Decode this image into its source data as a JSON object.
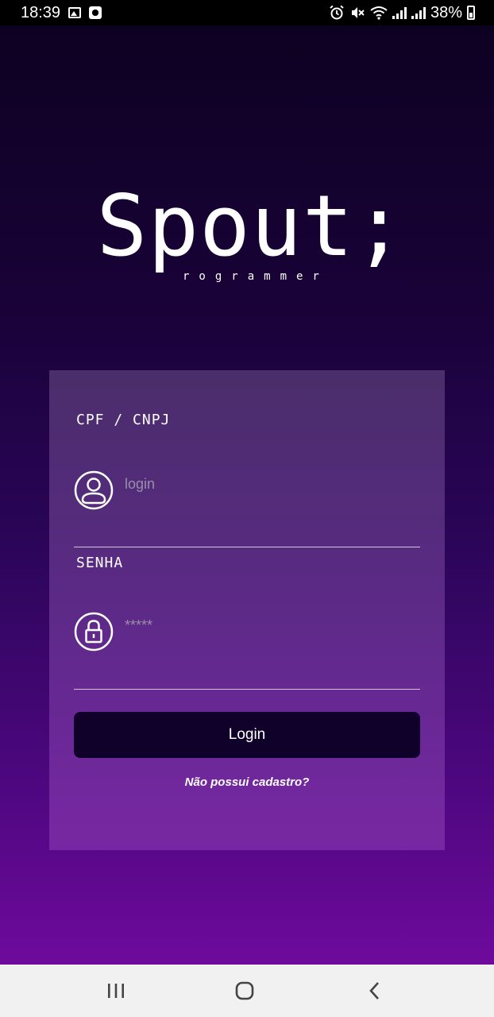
{
  "status_bar": {
    "time": "18:39",
    "battery": "38%",
    "icons": [
      "image-icon",
      "record-icon",
      "alarm-icon",
      "mute-icon",
      "wifi-icon",
      "signal-icon",
      "signal-icon",
      "battery-icon"
    ]
  },
  "logo": {
    "word": "Spout;",
    "subtitle": "rogrammer"
  },
  "form": {
    "cpf_label": "CPF / CNPJ",
    "login_placeholder": "login",
    "password_label": "SENHA",
    "password_placeholder": "*****",
    "login_button": "Login",
    "register_link": "Não possui cadastro?"
  },
  "nav_bar": {
    "icons": [
      "recent-apps-icon",
      "home-icon",
      "back-icon"
    ]
  },
  "colors": {
    "background_top": "#0d0122",
    "background_bottom": "#6e0a9c",
    "button": "#10012a",
    "nav_bar": "#f1f1f1"
  }
}
